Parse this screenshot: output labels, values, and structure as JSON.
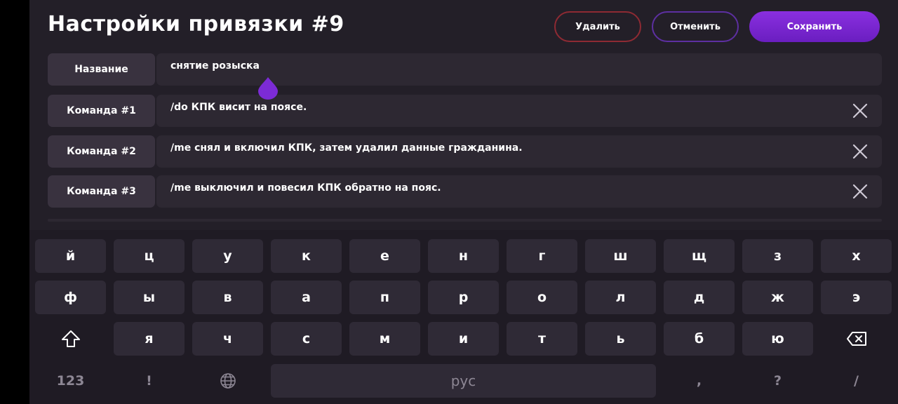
{
  "header": {
    "title": "Настройки привязки #9",
    "delete_label": "Удалить",
    "cancel_label": "Отменить",
    "save_label": "Сохранить"
  },
  "rows": [
    {
      "label": "Название",
      "value": "снятие розыска",
      "closable": false
    },
    {
      "label": "Команда #1",
      "value": "/do КПК висит на поясе.",
      "closable": true
    },
    {
      "label": "Команда #2",
      "value": "/me снял и включил КПК, затем удалил данные гражданина.",
      "closable": true
    },
    {
      "label": "Команда #3",
      "value": "/me выключил и повесил КПК обратно на пояс.",
      "closable": true
    }
  ],
  "keyboard": {
    "row1": [
      "й",
      "ц",
      "у",
      "к",
      "е",
      "н",
      "г",
      "ш",
      "щ",
      "з",
      "х"
    ],
    "row2": [
      "ф",
      "ы",
      "в",
      "а",
      "п",
      "р",
      "о",
      "л",
      "д",
      "ж",
      "э"
    ],
    "row3": [
      "я",
      "ч",
      "с",
      "м",
      "и",
      "т",
      "ь",
      "б",
      "ю"
    ],
    "numbers_label": "123",
    "exclaim_label": "!",
    "space_label": "рус",
    "comma_label": ",",
    "question_label": "?",
    "slash_label": "/"
  },
  "icons": {
    "close": "close-icon",
    "shift": "shift-icon",
    "backspace": "backspace-icon",
    "globe": "globe-icon",
    "cursor_handle": "text-cursor-handle-icon"
  },
  "colors": {
    "background": "#231f28",
    "accent": "#7c2bd6",
    "delete_border": "#8e2a33",
    "cancel_border": "#5d2fa1"
  }
}
